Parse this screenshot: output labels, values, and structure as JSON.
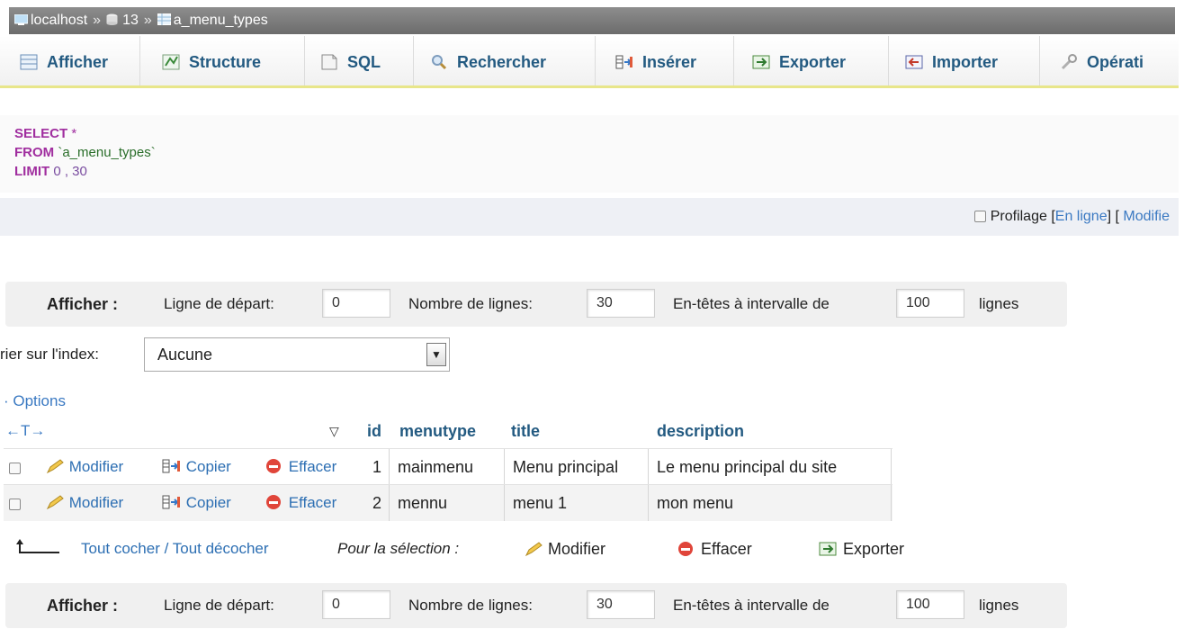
{
  "breadcrumb": {
    "server": "localhost",
    "database": "13",
    "table": "a_menu_types",
    "separator": "»"
  },
  "tabs": [
    {
      "label": "Afficher",
      "icon": "browse-icon"
    },
    {
      "label": "Structure",
      "icon": "structure-icon"
    },
    {
      "label": "SQL",
      "icon": "sql-icon"
    },
    {
      "label": "Rechercher",
      "icon": "search-icon"
    },
    {
      "label": "Insérer",
      "icon": "insert-icon"
    },
    {
      "label": "Exporter",
      "icon": "export-icon"
    },
    {
      "label": "Importer",
      "icon": "import-icon"
    },
    {
      "label": "Opérati",
      "icon": "wrench-icon"
    }
  ],
  "sql": {
    "select_kw": "SELECT",
    "select_rest": " *",
    "from_kw": "FROM",
    "from_rest": " `a_menu_types`",
    "limit_kw": "LIMIT",
    "limit_rest": " 0 , 30"
  },
  "profiling": {
    "label": "Profilage",
    "link_inline": "En ligne",
    "link_modify": "Modifie",
    "open_bracket": "[",
    "close_bracket": "]"
  },
  "navigation": {
    "show_label": "Afficher :",
    "start_label": "Ligne de départ:",
    "start_value": "0",
    "rows_label": "Nombre de lignes:",
    "rows_value": "30",
    "headers_label": "En-têtes à intervalle de",
    "headers_value": "100",
    "lines_label": "lignes"
  },
  "sort": {
    "label": "rier sur l'index:",
    "selected": "Aucune"
  },
  "options_label": "· Options",
  "table": {
    "resize_hint": "←T→",
    "columns": [
      "id",
      "menutype",
      "title",
      "description"
    ],
    "actions": {
      "edit": "Modifier",
      "copy": "Copier",
      "delete": "Effacer"
    },
    "rows": [
      {
        "id": "1",
        "menutype": "mainmenu",
        "title": "Menu principal",
        "description": "Le menu principal du site"
      },
      {
        "id": "2",
        "menutype": "mennu",
        "title": "menu 1",
        "description": "mon menu"
      }
    ]
  },
  "bulk": {
    "check_all": "Tout cocher / Tout décocher",
    "with_selected": "Pour la sélection :",
    "edit": "Modifier",
    "delete": "Effacer",
    "export": "Exporter"
  },
  "colors": {
    "link": "#235a81",
    "keyword": "#a02e9f",
    "tab_underline": "#e8e68a"
  }
}
